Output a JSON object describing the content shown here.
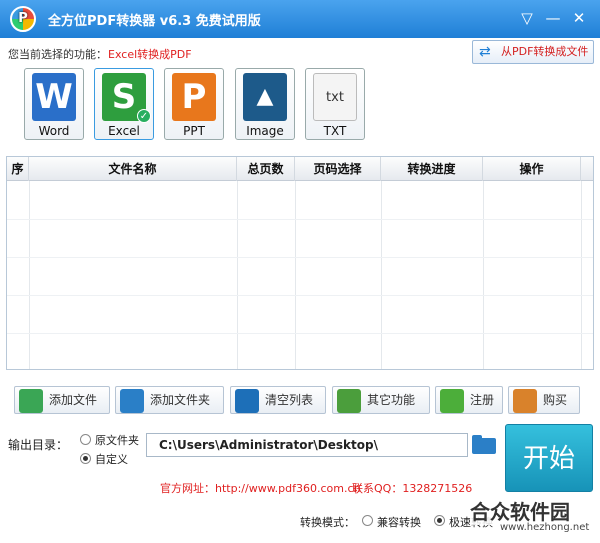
{
  "window": {
    "title": "全方位PDF转换器 v6.3 免费试用版",
    "icons": {
      "logo": "app-logo-icon",
      "menu": "dropdown-icon",
      "minimize": "minimize-icon",
      "close": "close-icon"
    },
    "menu_glyph": "▽",
    "minimize_glyph": "—",
    "close_glyph": "✕"
  },
  "function": {
    "label": "您当前选择的功能：",
    "value": "Excel转换成PDF",
    "switch_label": "从PDF转换成文件",
    "switch_glyph": "⇄"
  },
  "formats": [
    {
      "name": "Word",
      "glyph": "W",
      "color": "#2a6fc9",
      "selected": false
    },
    {
      "name": "Excel",
      "glyph": "S",
      "color": "#2e9e3e",
      "selected": true
    },
    {
      "name": "PPT",
      "glyph": "P",
      "color": "#e8771c",
      "selected": false
    },
    {
      "name": "Image",
      "glyph": "▲",
      "color": "#1d5a8a",
      "selected": false
    },
    {
      "name": "TXT",
      "glyph": "txt",
      "color": "#f4f4f4",
      "selected": false
    }
  ],
  "table": {
    "columns": [
      "序",
      "文件名称",
      "总页数",
      "页码选择",
      "转换进度",
      "操作"
    ],
    "rows": []
  },
  "toolbar": [
    {
      "label": "添加文件",
      "icon": "add-file-icon",
      "color": "#3aa655"
    },
    {
      "label": "添加文件夹",
      "icon": "add-folder-icon",
      "color": "#2a7fc7"
    },
    {
      "label": "清空列表",
      "icon": "clear-list-icon",
      "color": "#1d6fb8"
    },
    {
      "label": "其它功能",
      "icon": "other-functions-icon",
      "color": "#4b9e3c"
    },
    {
      "label": "注册",
      "icon": "register-icon",
      "color": "#4cae3a"
    },
    {
      "label": "购买",
      "icon": "buy-icon",
      "color": "#d9822b"
    }
  ],
  "output": {
    "label": "输出目录：",
    "options": [
      {
        "label": "原文件夹",
        "checked": false
      },
      {
        "label": "自定义",
        "checked": true
      }
    ],
    "path": "C:\\Users\\Administrator\\Desktop\\",
    "folder_icon": "folder-icon"
  },
  "start_label": "开始",
  "footer": {
    "site": "官方网址：http://www.pdf360.com.cn",
    "qq": "联系QQ：1328271526"
  },
  "mode": {
    "label": "转换模式：",
    "options": [
      {
        "label": "兼容转换",
        "checked": false
      },
      {
        "label": "极速转换",
        "checked": true
      }
    ]
  },
  "watermark": {
    "main": "合众软件园",
    "sub": "www.hezhong.net"
  }
}
